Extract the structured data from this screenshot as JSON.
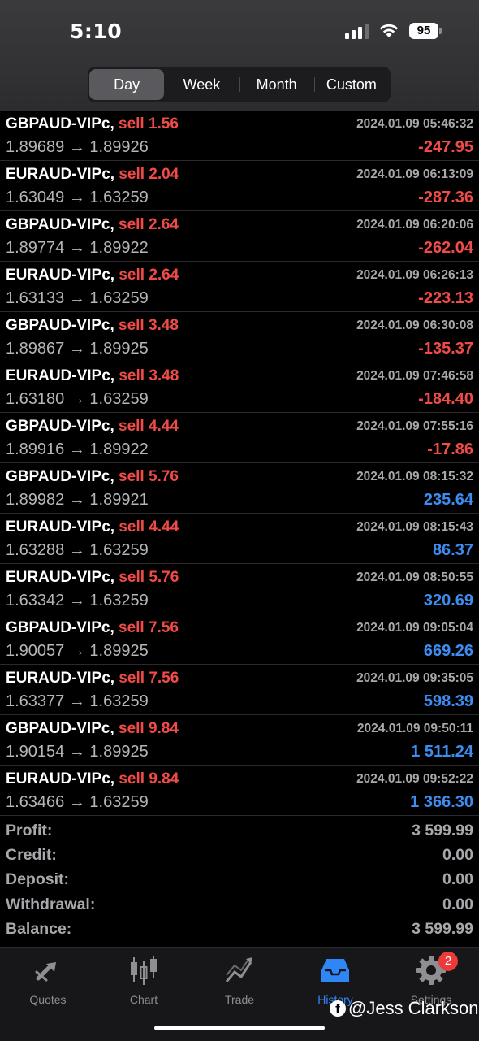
{
  "status_bar": {
    "time": "5:10",
    "battery": "95"
  },
  "period_tabs": [
    {
      "label": "Day",
      "active": true
    },
    {
      "label": "Week",
      "active": false
    },
    {
      "label": "Month",
      "active": false
    },
    {
      "label": "Custom",
      "active": false
    }
  ],
  "trades": [
    {
      "symbol": "GBPAUD-VIPc,",
      "side": "sell 1.56",
      "time": "2024.01.09 05:46:32",
      "open": "1.89689",
      "close": "1.89926",
      "profit": "-247.95",
      "negative": true
    },
    {
      "symbol": "EURAUD-VIPc,",
      "side": "sell 2.04",
      "time": "2024.01.09 06:13:09",
      "open": "1.63049",
      "close": "1.63259",
      "profit": "-287.36",
      "negative": true
    },
    {
      "symbol": "GBPAUD-VIPc,",
      "side": "sell 2.64",
      "time": "2024.01.09 06:20:06",
      "open": "1.89774",
      "close": "1.89922",
      "profit": "-262.04",
      "negative": true
    },
    {
      "symbol": "EURAUD-VIPc,",
      "side": "sell 2.64",
      "time": "2024.01.09 06:26:13",
      "open": "1.63133",
      "close": "1.63259",
      "profit": "-223.13",
      "negative": true
    },
    {
      "symbol": "GBPAUD-VIPc,",
      "side": "sell 3.48",
      "time": "2024.01.09 06:30:08",
      "open": "1.89867",
      "close": "1.89925",
      "profit": "-135.37",
      "negative": true
    },
    {
      "symbol": "EURAUD-VIPc,",
      "side": "sell 3.48",
      "time": "2024.01.09 07:46:58",
      "open": "1.63180",
      "close": "1.63259",
      "profit": "-184.40",
      "negative": true
    },
    {
      "symbol": "GBPAUD-VIPc,",
      "side": "sell 4.44",
      "time": "2024.01.09 07:55:16",
      "open": "1.89916",
      "close": "1.89922",
      "profit": "-17.86",
      "negative": true
    },
    {
      "symbol": "GBPAUD-VIPc,",
      "side": "sell 5.76",
      "time": "2024.01.09 08:15:32",
      "open": "1.89982",
      "close": "1.89921",
      "profit": "235.64",
      "negative": false
    },
    {
      "symbol": "EURAUD-VIPc,",
      "side": "sell 4.44",
      "time": "2024.01.09 08:15:43",
      "open": "1.63288",
      "close": "1.63259",
      "profit": "86.37",
      "negative": false
    },
    {
      "symbol": "EURAUD-VIPc,",
      "side": "sell 5.76",
      "time": "2024.01.09 08:50:55",
      "open": "1.63342",
      "close": "1.63259",
      "profit": "320.69",
      "negative": false
    },
    {
      "symbol": "GBPAUD-VIPc,",
      "side": "sell 7.56",
      "time": "2024.01.09 09:05:04",
      "open": "1.90057",
      "close": "1.89925",
      "profit": "669.26",
      "negative": false
    },
    {
      "symbol": "EURAUD-VIPc,",
      "side": "sell 7.56",
      "time": "2024.01.09 09:35:05",
      "open": "1.63377",
      "close": "1.63259",
      "profit": "598.39",
      "negative": false
    },
    {
      "symbol": "GBPAUD-VIPc,",
      "side": "sell 9.84",
      "time": "2024.01.09 09:50:11",
      "open": "1.90154",
      "close": "1.89925",
      "profit": "1 511.24",
      "negative": false
    },
    {
      "symbol": "EURAUD-VIPc,",
      "side": "sell 9.84",
      "time": "2024.01.09 09:52:22",
      "open": "1.63466",
      "close": "1.63259",
      "profit": "1 366.30",
      "negative": false
    }
  ],
  "arrow": "→",
  "summary": [
    {
      "label": "Profit:",
      "value": "3 599.99"
    },
    {
      "label": "Credit:",
      "value": "0.00"
    },
    {
      "label": "Deposit:",
      "value": "0.00"
    },
    {
      "label": "Withdrawal:",
      "value": "0.00"
    },
    {
      "label": "Balance:",
      "value": "3 599.99"
    }
  ],
  "tab_bar": [
    {
      "label": "Quotes",
      "icon": "quotes-icon",
      "active": false
    },
    {
      "label": "Chart",
      "icon": "chart-icon",
      "active": false
    },
    {
      "label": "Trade",
      "icon": "trade-icon",
      "active": false
    },
    {
      "label": "History",
      "icon": "history-icon",
      "active": true
    },
    {
      "label": "Settings",
      "icon": "settings-icon",
      "active": false,
      "badge": "2"
    }
  ],
  "colors": {
    "loss": "#ef4b48",
    "gain": "#3d8cf0",
    "active_tab": "#2f86f6"
  },
  "watermark": {
    "text": "@Jess Clarkson",
    "icon": "facebook-icon"
  }
}
